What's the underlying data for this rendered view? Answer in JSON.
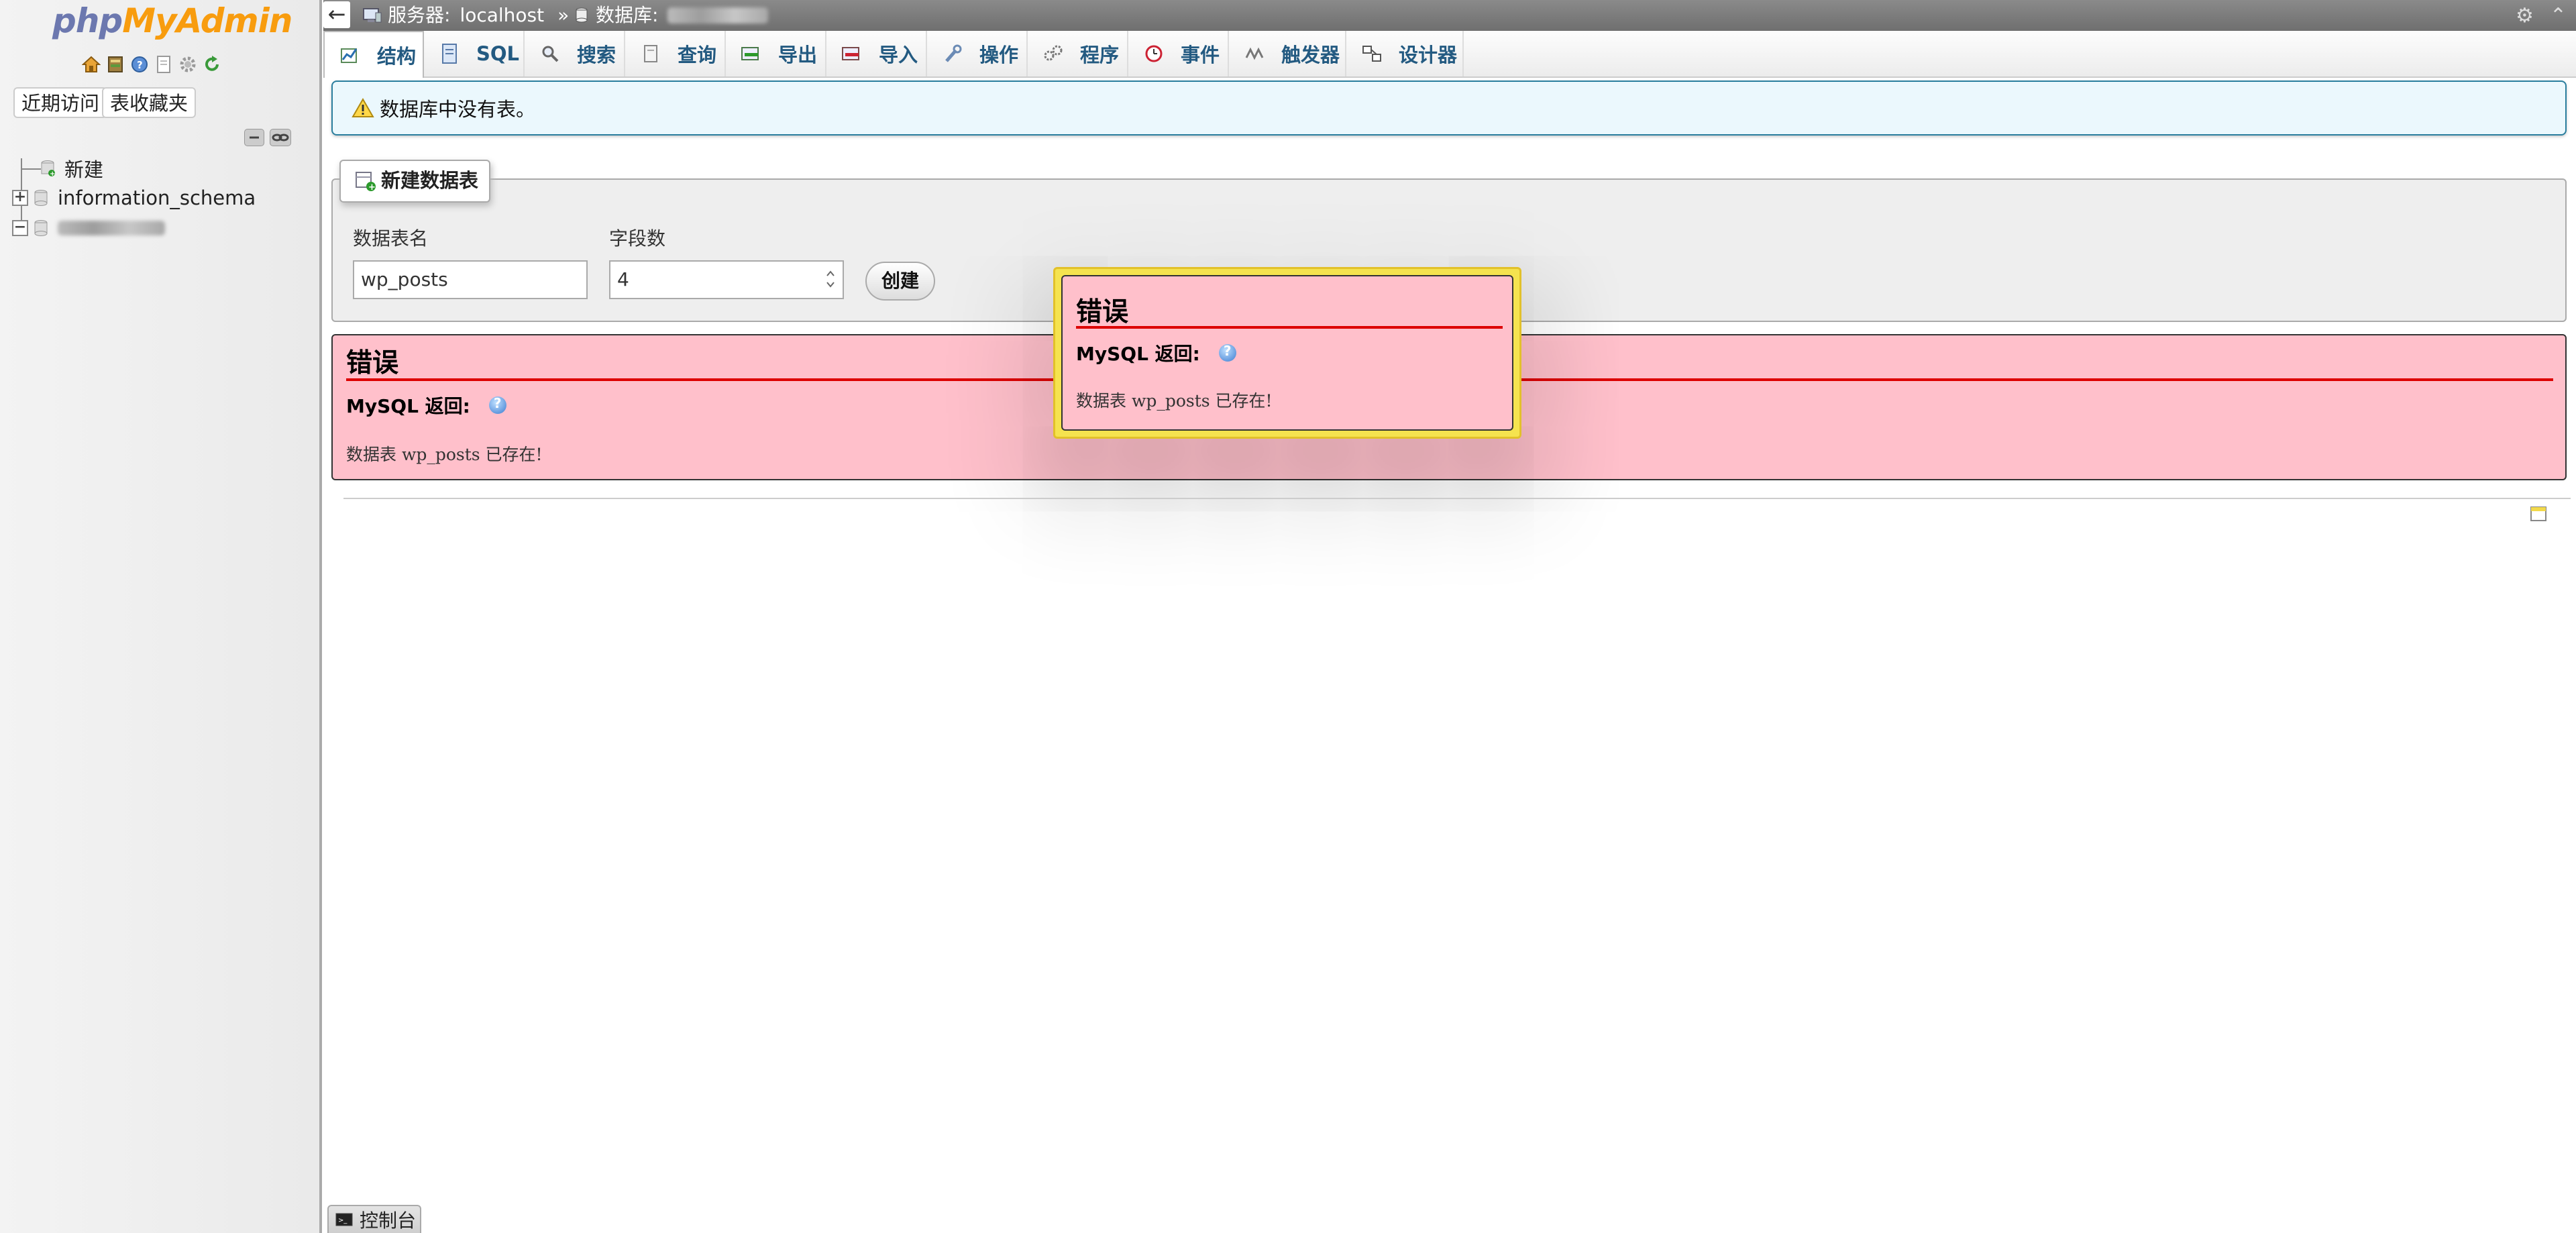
{
  "nav": {
    "logo_php": "php",
    "logo_myadmin": "MyAdmin",
    "logo_icons": [
      "home-icon",
      "database-icon",
      "help-icon",
      "docs-icon",
      "settings-icon",
      "reload-icon"
    ],
    "recent_label": "近期访问",
    "favorites_label": "表收藏夹",
    "tree": {
      "new_label": "新建",
      "db1": "information_schema"
    }
  },
  "topbar": {
    "server_label": "服务器:",
    "server_value": "localhost",
    "separator": "»",
    "database_label": "数据库:"
  },
  "tabs": [
    {
      "label": "结构",
      "icon": "structure-icon"
    },
    {
      "label": "SQL",
      "icon": "sql-icon"
    },
    {
      "label": "搜索",
      "icon": "search-icon"
    },
    {
      "label": "查询",
      "icon": "query-icon"
    },
    {
      "label": "导出",
      "icon": "export-icon"
    },
    {
      "label": "导入",
      "icon": "import-icon"
    },
    {
      "label": "操作",
      "icon": "wrench-icon"
    },
    {
      "label": "程序",
      "icon": "routines-icon"
    },
    {
      "label": "事件",
      "icon": "events-icon"
    },
    {
      "label": "触发器",
      "icon": "triggers-icon"
    },
    {
      "label": "设计器",
      "icon": "designer-icon"
    }
  ],
  "notice": {
    "text": "数据库中没有表。"
  },
  "create_table": {
    "legend": "新建数据表",
    "name_label": "数据表名",
    "name_value": "wp_posts",
    "fields_label": "字段数",
    "fields_value": "4",
    "create_button": "创建"
  },
  "error": {
    "title": "错误",
    "mysql_returned": "MySQL 返回:",
    "message": "数据表 wp_posts 已存在!"
  },
  "popup": {
    "title": "错误",
    "mysql_returned": "MySQL 返回:",
    "message": "数据表 wp_posts 已存在!"
  },
  "console": {
    "label": "控制台"
  },
  "colors": {
    "tab_text": "#235a81",
    "error_bg": "#ffc0cb",
    "error_rule": "#dd0000",
    "notice_bg": "#ebf8fd",
    "popup_border": "#f5e34f",
    "logo_php": "#6c78af",
    "logo_myadmin": "#f89c0e"
  }
}
